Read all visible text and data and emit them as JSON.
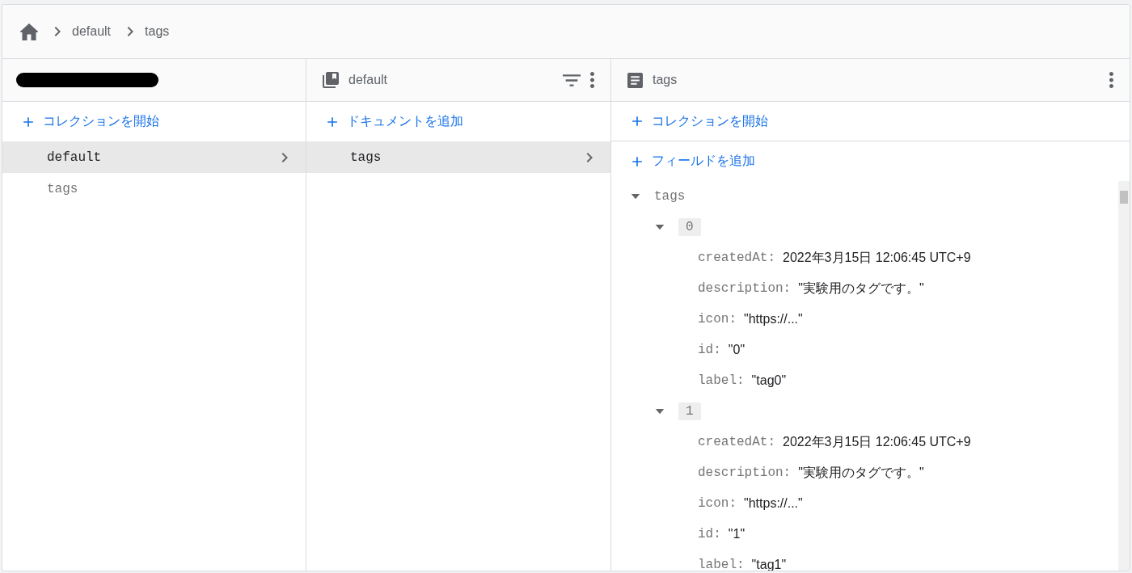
{
  "breadcrumb": [
    {
      "label": "default"
    },
    {
      "label": "tags"
    }
  ],
  "collections_panel": {
    "action": "コレクションを開始",
    "items": [
      {
        "label": "default",
        "selected": true
      },
      {
        "label": "tags",
        "selected": false
      }
    ]
  },
  "documents_panel": {
    "title": "default",
    "action": "ドキュメントを追加",
    "items": [
      {
        "label": "tags",
        "selected": true
      }
    ]
  },
  "document_panel": {
    "title": "tags",
    "actions": [
      "コレクションを開始",
      "フィールドを追加"
    ],
    "fields": [
      {
        "key": "tags",
        "kind": "field",
        "expanded": true,
        "children": [
          {
            "key": "0",
            "kind": "index",
            "expanded": true,
            "children": [
              {
                "key": "createdAt:",
                "kind": "leaf",
                "value": "2022年3月15日 12:06:45 UTC+9"
              },
              {
                "key": "description:",
                "kind": "leaf",
                "value": "\"実験用のタグです。\""
              },
              {
                "key": "icon:",
                "kind": "leaf",
                "value": "\"https://...\""
              },
              {
                "key": "id:",
                "kind": "leaf",
                "value": "\"0\""
              },
              {
                "key": "label:",
                "kind": "leaf",
                "value": "\"tag0\""
              }
            ]
          },
          {
            "key": "1",
            "kind": "index",
            "expanded": true,
            "children": [
              {
                "key": "createdAt:",
                "kind": "leaf",
                "value": "2022年3月15日 12:06:45 UTC+9"
              },
              {
                "key": "description:",
                "kind": "leaf",
                "value": "\"実験用のタグです。\""
              },
              {
                "key": "icon:",
                "kind": "leaf",
                "value": "\"https://...\""
              },
              {
                "key": "id:",
                "kind": "leaf",
                "value": "\"1\""
              },
              {
                "key": "label:",
                "kind": "leaf",
                "value": "\"tag1\""
              }
            ]
          }
        ]
      }
    ]
  }
}
